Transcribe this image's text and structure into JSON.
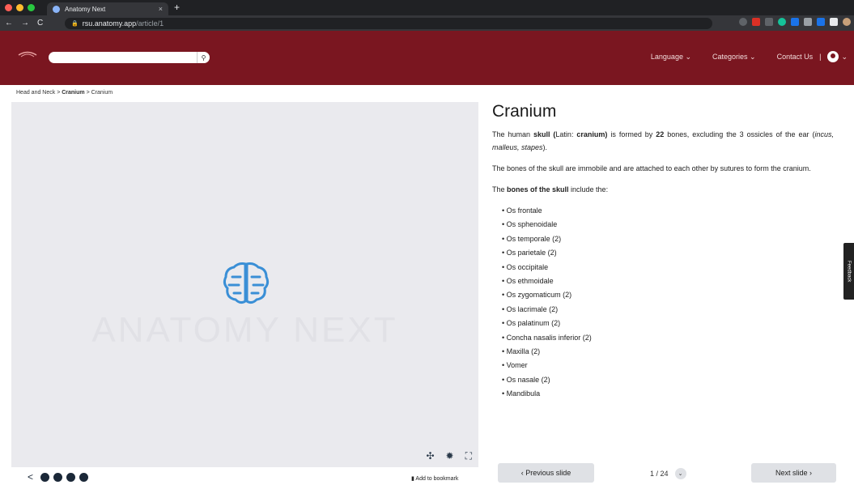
{
  "browser": {
    "tab_title": "Anatomy Next",
    "tab_close": "×",
    "new_tab": "+",
    "url_host": "rsu.anatomy.app",
    "url_path": "/article/1",
    "nav_back": "←",
    "nav_forward": "→",
    "nav_reload": "C"
  },
  "header": {
    "search_placeholder": "",
    "search_icon": "⚲",
    "language": "Language ⌄",
    "categories": "Categories ⌄",
    "separator": "|",
    "contact": "Contact Us",
    "user_caret": "⌄"
  },
  "breadcrumb": {
    "part1": "Head and Neck > ",
    "part2": "Cranium",
    "part3": " > Cranium"
  },
  "viewer": {
    "watermark": "ANATOMY NEXT",
    "controls": [
      "move-icon",
      "settings-icon",
      "fullscreen-icon"
    ]
  },
  "share": {
    "bookmark": "Add to bookmark"
  },
  "article": {
    "title": "Cranium",
    "p1_a": "The human ",
    "p1_b": "skull (",
    "p1_c": "Latin: ",
    "p1_d": "cranium)",
    "p1_e": " is formed by ",
    "p1_f": "22",
    "p1_g": " bones, excluding the 3 ossicles of the ear (",
    "p1_h": "incus, malleus, stapes",
    "p1_i": ").",
    "p2": "The bones of the skull are immobile and are attached to each other by sutures to form the cranium.",
    "p3_a": "The ",
    "p3_b": "bones of the skull",
    "p3_c": " include the:",
    "bones": [
      "Os frontale",
      "Os sphenoidale",
      "Os temporale (2)",
      "Os parietale (2)",
      "Os occipitale",
      "Os ethmoidale",
      "Os zygomaticum (2)",
      "Os lacrimale (2)",
      "Os palatinum (2)",
      "Concha nasalis inferior (2)",
      "Maxilla (2)",
      "Vomer",
      "Os nasale (2)",
      "Mandibula"
    ]
  },
  "slides": {
    "prev": "‹  Previous slide",
    "next": "Next slide  ›",
    "counter": "1 / 24",
    "caret": "⌄"
  },
  "feedback": "Feedback",
  "colors": {
    "brand": "#7a1620",
    "brain": "#3a8fd6"
  }
}
